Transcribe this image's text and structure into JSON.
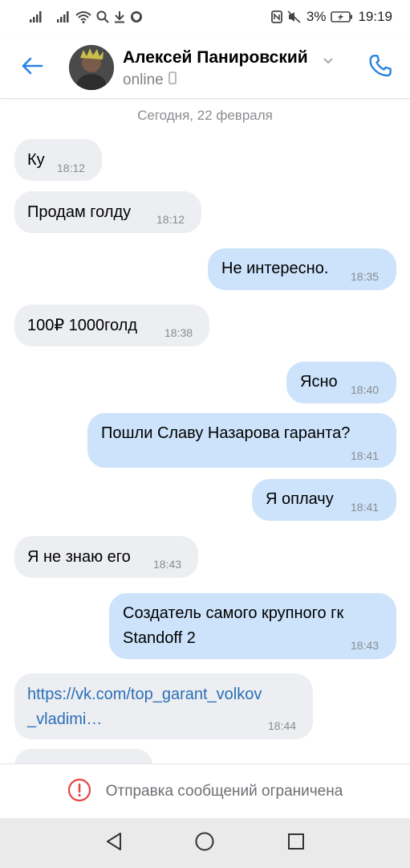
{
  "status_bar": {
    "battery": "3%",
    "time": "19:19"
  },
  "header": {
    "contact_name": "Алексей Панировский",
    "status": "online"
  },
  "date_separator": "Сегодня, 22 февраля",
  "messages": [
    {
      "dir": "in",
      "text": "Ку",
      "time": "18:12"
    },
    {
      "dir": "in",
      "text": "Продам голду",
      "time": "18:12"
    },
    {
      "dir": "out",
      "text": "Не интересно.",
      "time": "18:35"
    },
    {
      "dir": "in",
      "text": "100₽ 1000голд",
      "time": "18:38"
    },
    {
      "dir": "out",
      "text": "Ясно",
      "time": "18:40"
    },
    {
      "dir": "out",
      "text": "Пошли Славу Назарова гаранта?",
      "time": "18:41"
    },
    {
      "dir": "out",
      "text": "Я оплачу",
      "time": "18:41"
    },
    {
      "dir": "in",
      "text": "Я не знаю его",
      "time": "18:43"
    },
    {
      "dir": "out",
      "line1": "Создатель самого крупного гк",
      "line2": "Standoff 2",
      "time": "18:43"
    },
    {
      "dir": "in",
      "line1": "https://vk.com/top_garant_volkov",
      "line2": "_vladimi…",
      "time": "18:44"
    }
  ],
  "bottom_bar": {
    "text": "Отправка сообщений ограничена",
    "icon": "alert-circle-icon"
  },
  "colors": {
    "accent": "#2a82e4",
    "incoming_bubble": "#eceef1",
    "outgoing_bubble": "#cce3fb",
    "alert": "#e64646"
  }
}
